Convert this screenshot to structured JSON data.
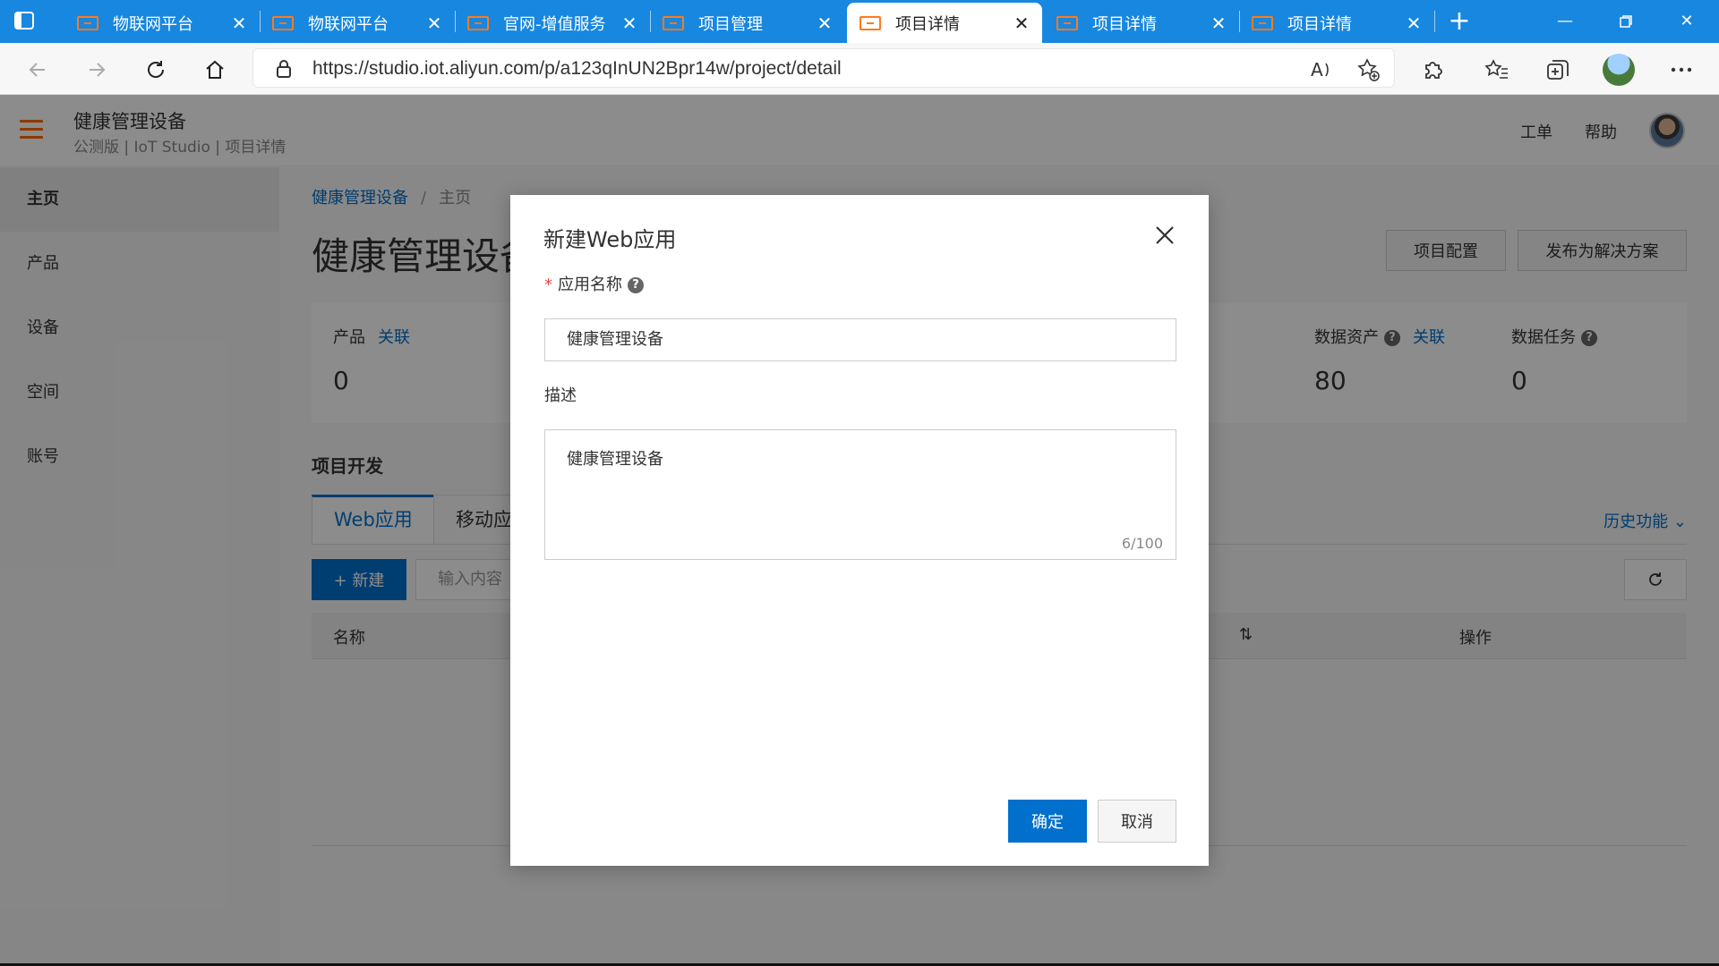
{
  "browser": {
    "tabs": [
      {
        "title": "物联网平台",
        "active": false
      },
      {
        "title": "物联网平台",
        "active": false
      },
      {
        "title": "官网-增值服务",
        "active": false
      },
      {
        "title": "项目管理",
        "active": false
      },
      {
        "title": "项目详情",
        "active": true
      },
      {
        "title": "项目详情",
        "active": false
      },
      {
        "title": "项目详情",
        "active": false
      }
    ],
    "url": "https://studio.iot.aliyun.com/p/a123qInUN2Bpr14w/project/detail"
  },
  "header": {
    "title": "健康管理设备",
    "subtitle": "公测版 | IoT Studio | 项目详情",
    "links": [
      "工单",
      "帮助"
    ]
  },
  "sidebar": {
    "items": [
      {
        "label": "主页",
        "active": true
      },
      {
        "label": "产品",
        "active": false
      },
      {
        "label": "设备",
        "active": false
      },
      {
        "label": "空间",
        "active": false
      },
      {
        "label": "账号",
        "active": false
      }
    ]
  },
  "main": {
    "breadcrumb": {
      "root": "健康管理设备",
      "current": "主页"
    },
    "title": "健康管理设备",
    "actions": {
      "config": "项目配置",
      "publish": "发布为解决方案"
    },
    "stats": [
      {
        "label": "产品",
        "link": "关联",
        "value": "0"
      },
      {
        "label": "数据资产",
        "link": "关联",
        "value": "80"
      },
      {
        "label": "数据任务",
        "link": "",
        "value": "0"
      }
    ],
    "section_title": "项目开发",
    "tabs": [
      "Web应用",
      "移动应用"
    ],
    "history": "历史功能",
    "new_button": "+ 新建",
    "filter_placeholder": "输入内容",
    "table_headers": {
      "name": "名称",
      "actions": "操作"
    }
  },
  "modal": {
    "title": "新建Web应用",
    "name_label": "应用名称",
    "name_value": "健康管理设备",
    "desc_label": "描述",
    "desc_value": "健康管理设备",
    "counter": "6/100",
    "confirm": "确定",
    "cancel": "取消"
  }
}
